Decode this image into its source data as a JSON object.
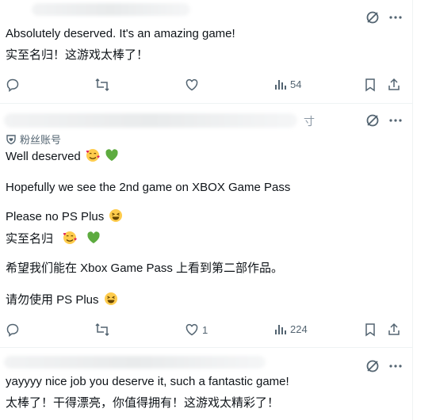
{
  "posts": [
    {
      "lines": [
        "Absolutely deserved. It's an amazing game!",
        "实至名归！这游戏太棒了！"
      ],
      "actions": {
        "reply": "",
        "repost": "",
        "like": "",
        "views": "54"
      }
    },
    {
      "badge": "粉丝账号",
      "trail_char": "寸",
      "lines": [
        "Well deserved",
        "Hopefully we see the 2nd game on XBOX Game Pass",
        "Please no PS Plus",
        "实至名归",
        "希望我们能在 Xbox Game Pass 上看到第二部作品。",
        "请勿使用 PS Plus"
      ],
      "actions": {
        "reply": "",
        "repost": "",
        "like": "1",
        "views": "224"
      }
    },
    {
      "lines": [
        "yayyyy nice job you deserve it, such a fantastic game!",
        "太棒了！干得漂亮，你值得拥有！这游戏太精彩了！"
      ]
    }
  ],
  "icons": {
    "grok": "grok-icon",
    "more": "more-icon",
    "reply": "reply-icon",
    "repost": "repost-icon",
    "like": "like-icon",
    "views": "views-icon",
    "bookmark": "bookmark-icon",
    "share": "share-icon",
    "smile_hearts": "smiling-face-with-hearts-emoji",
    "green_heart": "green-heart-emoji",
    "grin": "grinning-squinting-face-emoji"
  }
}
